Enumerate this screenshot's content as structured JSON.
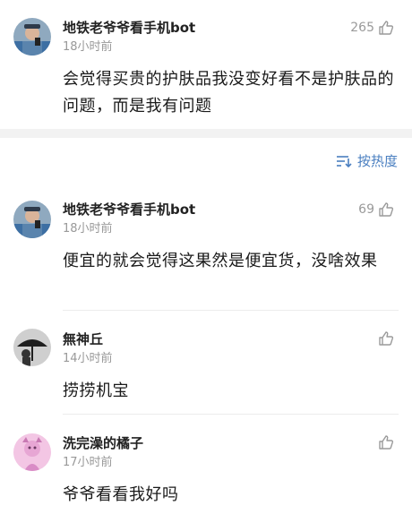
{
  "sort": {
    "label": "按热度"
  },
  "comments": [
    {
      "username": "地铁老爷爷看手机bot",
      "time": "18小时前",
      "likes": "265",
      "text": "会觉得买贵的护肤品我没变好看不是护肤品的问题，而是我有问题",
      "avatar": "old-man-phone-avatar"
    },
    {
      "username": "地铁老爷爷看手机bot",
      "time": "18小时前",
      "likes": "69",
      "text": "便宜的就会觉得这果然是便宜货，没啥效果",
      "avatar": "old-man-phone-avatar"
    },
    {
      "username": "無神丘",
      "time": "14小时前",
      "likes": "",
      "text": "捞捞机宝",
      "avatar": "umbrella-figure-avatar"
    },
    {
      "username": "洗完澡的橘子",
      "time": "17小时前",
      "likes": "",
      "text": "爷爷看看我好吗",
      "avatar": "pink-character-avatar"
    }
  ]
}
